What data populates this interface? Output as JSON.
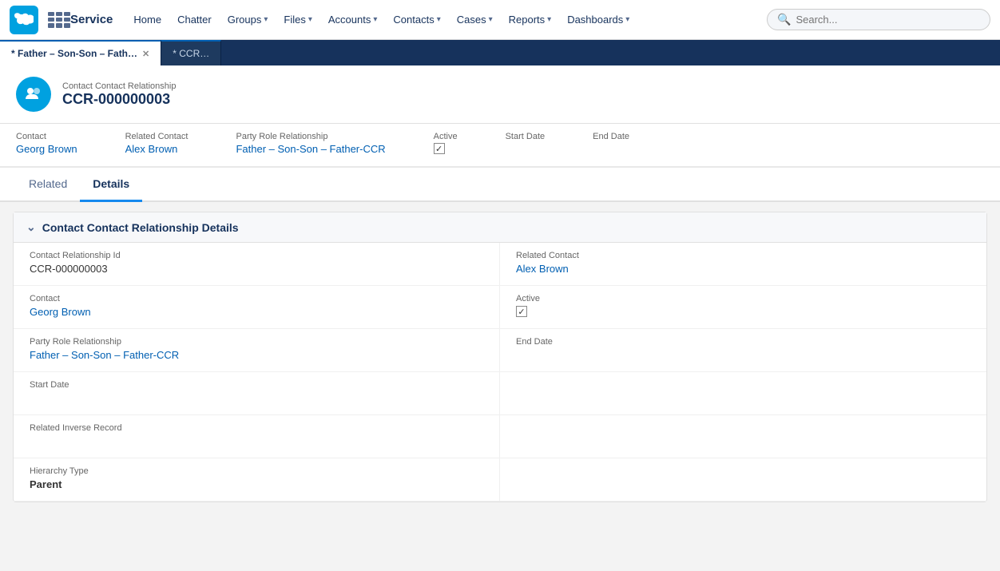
{
  "logo": {
    "alt": "Salesforce"
  },
  "app_name": "Service",
  "nav": {
    "items": [
      {
        "label": "Home",
        "has_dropdown": false
      },
      {
        "label": "Chatter",
        "has_dropdown": false
      },
      {
        "label": "Groups",
        "has_dropdown": true
      },
      {
        "label": "Files",
        "has_dropdown": true
      },
      {
        "label": "Accounts",
        "has_dropdown": true
      },
      {
        "label": "Contacts",
        "has_dropdown": true
      },
      {
        "label": "Cases",
        "has_dropdown": true
      },
      {
        "label": "Reports",
        "has_dropdown": true
      },
      {
        "label": "Dashboards",
        "has_dropdown": true
      }
    ]
  },
  "search": {
    "placeholder": "Search..."
  },
  "tabs": [
    {
      "label": "* Father – Son-Son – Fath…",
      "active": true,
      "closeable": true
    },
    {
      "label": "* CCR…",
      "active": false,
      "closeable": false
    }
  ],
  "record": {
    "type": "Contact Contact Relationship",
    "id": "CCR-000000003",
    "icon_alt": "contact-relationship-icon"
  },
  "summary": {
    "contact": {
      "label": "Contact",
      "value": "Georg Brown"
    },
    "related_contact": {
      "label": "Related Contact",
      "value": "Alex Brown"
    },
    "party_role": {
      "label": "Party Role Relationship",
      "value": "Father – Son-Son – Father-CCR"
    },
    "active": {
      "label": "Active",
      "checked": true
    },
    "start_date": {
      "label": "Start Date",
      "value": ""
    },
    "end_date": {
      "label": "End Date",
      "value": ""
    }
  },
  "detail_tabs": [
    {
      "label": "Related",
      "active": false
    },
    {
      "label": "Details",
      "active": true
    }
  ],
  "section": {
    "title": "Contact Contact Relationship Details",
    "fields": {
      "contact_relationship_id": {
        "label": "Contact Relationship Id",
        "value": "CCR-000000003"
      },
      "related_contact": {
        "label": "Related Contact",
        "value": "Alex Brown",
        "is_link": true
      },
      "contact": {
        "label": "Contact",
        "value": "Georg Brown",
        "is_link": true
      },
      "active": {
        "label": "Active",
        "checked": true
      },
      "party_role": {
        "label": "Party Role Relationship",
        "value": "Father – Son-Son – Father-CCR",
        "is_link": true
      },
      "end_date": {
        "label": "End Date",
        "value": ""
      },
      "start_date": {
        "label": "Start Date",
        "value": ""
      },
      "start_date_right": {
        "label": "",
        "value": ""
      },
      "related_inverse": {
        "label": "Related Inverse Record",
        "value": ""
      },
      "related_inverse_right": {
        "label": "",
        "value": ""
      },
      "hierarchy_type": {
        "label": "Hierarchy Type",
        "value": "Parent",
        "is_bold": true
      },
      "hierarchy_right": {
        "label": "",
        "value": ""
      }
    }
  },
  "icons": {
    "edit": "✎",
    "collapse": "⌄",
    "check": "✓",
    "search": "🔍",
    "apps": "⋮⋮⋮"
  }
}
